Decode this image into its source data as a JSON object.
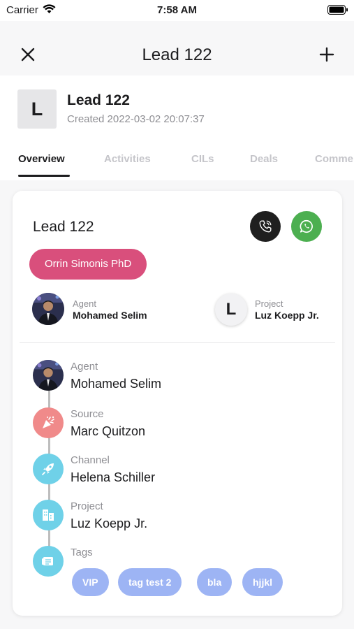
{
  "status_bar": {
    "carrier": "Carrier",
    "time": "7:58 AM"
  },
  "nav": {
    "title": "Lead 122",
    "close_icon": "close-icon",
    "add_icon": "plus-icon"
  },
  "header": {
    "avatar_initial": "L",
    "name": "Lead 122",
    "created": "Created 2022-03-02 20:07:37"
  },
  "tabs": [
    {
      "label": "Overview",
      "active": true
    },
    {
      "label": "Activities",
      "active": false
    },
    {
      "label": "CILs",
      "active": false
    },
    {
      "label": "Deals",
      "active": false
    },
    {
      "label": "Comme",
      "active": false
    }
  ],
  "card": {
    "title": "Lead 122",
    "call_icon": "phone-icon",
    "whatsapp_icon": "whatsapp-icon",
    "owner": "Orrin Simonis PhD",
    "agent": {
      "label": "Agent",
      "value": "Mohamed Selim"
    },
    "project": {
      "label": "Project",
      "value": "Luz Koepp Jr.",
      "initial": "L"
    }
  },
  "timeline": [
    {
      "label": "Agent",
      "value": "Mohamed Selim",
      "icon": "agent-photo"
    },
    {
      "label": "Source",
      "value": "Marc Quitzon",
      "icon": "party-popper-icon",
      "color": "#f08a8a"
    },
    {
      "label": "Channel",
      "value": "Helena Schiller",
      "icon": "rocket-icon",
      "color": "#6fd1e8"
    },
    {
      "label": "Project",
      "value": "Luz Koepp Jr.",
      "icon": "building-icon",
      "color": "#6fd1e8"
    },
    {
      "label": "Tags",
      "value": "",
      "icon": "tag-card-icon",
      "color": "#6fd1e8"
    }
  ],
  "tags": [
    "VIP",
    "tag test 2",
    "bla",
    "hjjkl"
  ],
  "colors": {
    "owner_pill": "#d94f7c",
    "tag": "#9db4f4",
    "whatsapp": "#4caf50",
    "call": "#1f1f1f"
  }
}
